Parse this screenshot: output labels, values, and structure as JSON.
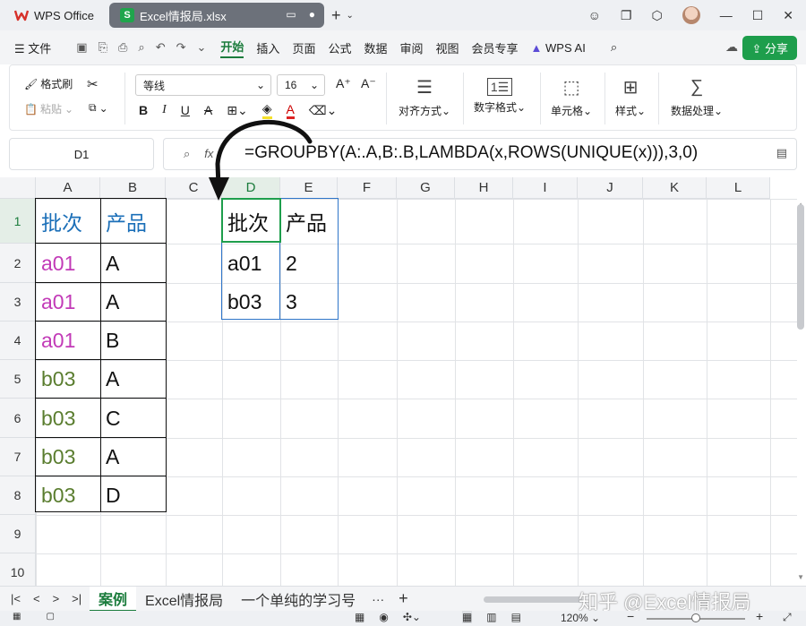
{
  "window": {
    "app_tab": "WPS Office",
    "file_tab": "Excel情报局.xlsx",
    "file_icon_letter": "S"
  },
  "menu": {
    "file": "文件",
    "items": [
      "开始",
      "插入",
      "页面",
      "公式",
      "数据",
      "审阅",
      "视图",
      "会员专享"
    ],
    "wps_ai": "WPS AI",
    "share": "分享"
  },
  "ribbon": {
    "format_painter": "格式刷",
    "paste": "粘贴",
    "font_name": "等线",
    "font_size": "16",
    "bold": "B",
    "italic": "I",
    "underline": "U",
    "strike": "A",
    "align": "对齐方式",
    "number_format": "数字格式",
    "cells": "单元格",
    "styles": "样式",
    "data_processing": "数据处理"
  },
  "formula_bar": {
    "name_box": "D1",
    "formula": "=GROUPBY(A:.A,B:.B,LAMBDA(x,ROWS(UNIQUE(x))),3,0)"
  },
  "grid": {
    "columns": [
      "A",
      "B",
      "C",
      "D",
      "E",
      "F",
      "G",
      "H",
      "I",
      "J",
      "K",
      "L"
    ],
    "rows": [
      "1",
      "2",
      "3",
      "4",
      "5",
      "6",
      "7",
      "8",
      "9",
      "10"
    ],
    "source_table": {
      "header": [
        "批次",
        "产品"
      ],
      "rows": [
        [
          "a01",
          "A"
        ],
        [
          "a01",
          "A"
        ],
        [
          "a01",
          "B"
        ],
        [
          "b03",
          "A"
        ],
        [
          "b03",
          "C"
        ],
        [
          "b03",
          "A"
        ],
        [
          "b03",
          "D"
        ]
      ]
    },
    "result_table": {
      "header": [
        "批次",
        "产品"
      ],
      "rows": [
        [
          "a01",
          "2"
        ],
        [
          "b03",
          "3"
        ]
      ]
    },
    "colors": {
      "header": "#1b6fb8",
      "a01": "#c23ab7",
      "b03": "#5a7d2f",
      "selection": "#1e9e4c"
    }
  },
  "sheets": {
    "tabs": [
      "案例",
      "Excel情报局",
      "一个单纯的学习号"
    ],
    "more": "···",
    "add": "+"
  },
  "watermark": "知乎 @Excel情报局",
  "status": {
    "zoom": "120%"
  }
}
